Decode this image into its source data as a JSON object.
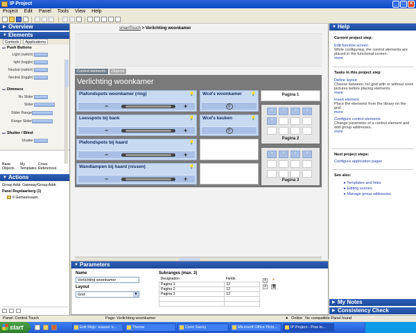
{
  "window": {
    "title": "IP Project"
  },
  "menu": [
    "Project",
    "Edit",
    "Panel",
    "Tools",
    "View",
    "Help"
  ],
  "left": {
    "overview_title": "Overview",
    "elements_title": "Elements",
    "subtabs": [
      "Controls",
      "Applications"
    ],
    "groups": [
      {
        "name": "Push Buttons",
        "items": [
          "Light (switch)",
          "light (toggle)",
          "Neutral (switch)",
          "Neutral (toggle)"
        ]
      },
      {
        "name": "Dimmers",
        "items": [
          "No Slider",
          "Slider",
          "Slider Range",
          "Range Slider"
        ]
      },
      {
        "name": "Shutter / Blind",
        "items": [
          "Shutter"
        ]
      }
    ],
    "bottom_tabs": [
      "Basic Objects",
      "My Templates",
      "Cross References"
    ],
    "actions_title": "Actions",
    "actions_tabs": "Group Addr.  Gateway/Group Addr.",
    "actions_items": [
      "Panel Regelaarberg (1)",
      "0 Gemeenvaam"
    ]
  },
  "center": {
    "breadcrumb_link": "smartTouch",
    "breadcrumb_sep": " > ",
    "breadcrumb_current": "Verlichting woonkamer",
    "tabs": [
      "Control elements",
      "Objects"
    ],
    "room_title": "Verlichting woonkamer",
    "dimmers": [
      {
        "label": "Plafondspots woonkamer (ring)"
      },
      {
        "label": "Leesspots bij bank"
      },
      {
        "label": "Plafondspots bij haard"
      },
      {
        "label": "Wandlampen bij haard (nissen)"
      }
    ],
    "switches": [
      {
        "label": "Wcd's woonkamer"
      },
      {
        "label": "Wcd's keuken"
      }
    ],
    "minus_sym": "−",
    "plus_sym": "+",
    "off_sym": "⦸",
    "pages": [
      "Pagina 1",
      "Pagina 2",
      "Pagina 3"
    ]
  },
  "params": {
    "title": "Parameters",
    "name_label": "Name",
    "name_value": "Verlichting woonkamer",
    "layout_label": "Layout",
    "layout_value": "Grid",
    "subranges_label": "Subranges (max. 3)",
    "table_headers": [
      "Designation",
      "Fields"
    ],
    "table_rows": [
      [
        "Pagina 1",
        "12"
      ],
      [
        "Pagina 2",
        "12"
      ],
      [
        "Pagina 3",
        "12"
      ]
    ]
  },
  "help": {
    "title": "Help",
    "current_step_title": "Current project step:",
    "current_step_link": "Edit function screen",
    "current_step_text": "While configuring, the control elements are placed in the functional screen.",
    "more": "more",
    "tasks_title": "Tasks in this project step",
    "tasks": [
      {
        "link": "Define layout",
        "text": "Choose between 'no' grid with or without room pictures before placing elements."
      },
      {
        "link": "Insert element",
        "text": "Place the elements from the library on the grid."
      },
      {
        "link": "Configure control elements",
        "text": "Change parameter of a control element and add group addresses."
      }
    ],
    "next_title": "Next project steps:",
    "next_link": "Configure application pages",
    "see_also_title": "See also:",
    "see_also": [
      "Templates and links",
      "Editing scenes",
      "Manage group addresses"
    ],
    "my_notes": "My Notes",
    "consistency": "Consistency Check"
  },
  "status": {
    "left": "Panel: Control Touch",
    "middle": "Page: Verlichting woonkamer",
    "online": "Online",
    "right": "No compatible Panel found"
  },
  "taskbar": {
    "start": "start",
    "tasks": [
      "Edit Mojo: wasser e...",
      "Theme",
      "Color Savvy",
      "Microsoft Office Picts...",
      "IP Project - Pow to..."
    ],
    "clock": ""
  }
}
